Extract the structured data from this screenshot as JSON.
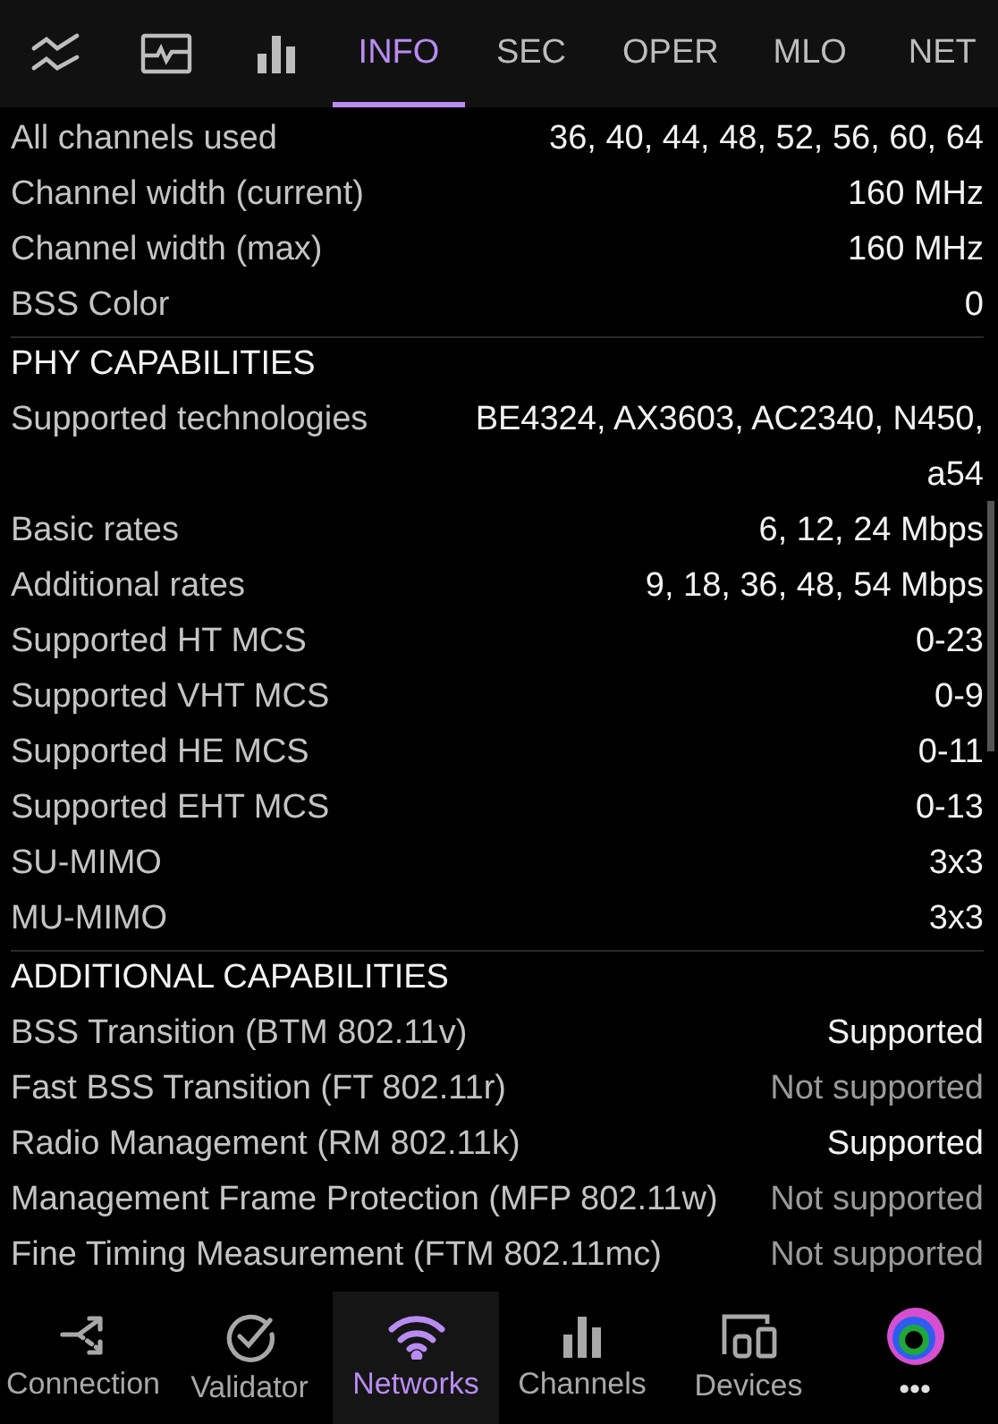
{
  "tabs": [
    {
      "kind": "icon",
      "selected": false
    },
    {
      "kind": "icon",
      "selected": false
    },
    {
      "kind": "icon",
      "selected": false
    },
    {
      "kind": "text",
      "label": "INFO",
      "selected": true
    },
    {
      "kind": "text",
      "label": "SEC",
      "selected": false
    },
    {
      "kind": "text",
      "label": "OPER",
      "selected": false
    },
    {
      "kind": "text",
      "label": "MLO",
      "selected": false
    },
    {
      "kind": "text",
      "label": "NET",
      "selected": false
    }
  ],
  "sections": [
    {
      "rows": [
        {
          "label": "All channels used",
          "value": "36, 40, 44, 48, 52, 56, 60, 64",
          "dimmed": false
        },
        {
          "label": "Channel width (current)",
          "value": "160 MHz",
          "dimmed": false
        },
        {
          "label": "Channel width (max)",
          "value": "160 MHz",
          "dimmed": false
        },
        {
          "label": "BSS Color",
          "value": "0",
          "dimmed": false
        }
      ]
    },
    {
      "title": "PHY CAPABILITIES",
      "rows": [
        {
          "label": "Supported technologies",
          "value": "BE4324, AX3603, AC2340, N450, a54",
          "dimmed": false
        },
        {
          "label": "Basic rates",
          "value": "6, 12, 24 Mbps",
          "dimmed": false
        },
        {
          "label": "Additional rates",
          "value": "9, 18, 36, 48, 54 Mbps",
          "dimmed": false
        },
        {
          "label": "Supported HT MCS",
          "value": "0-23",
          "dimmed": false
        },
        {
          "label": "Supported VHT MCS",
          "value": "0-9",
          "dimmed": false
        },
        {
          "label": "Supported HE MCS",
          "value": "0-11",
          "dimmed": false
        },
        {
          "label": "Supported EHT MCS",
          "value": "0-13",
          "dimmed": false
        },
        {
          "label": "SU-MIMO",
          "value": "3x3",
          "dimmed": false
        },
        {
          "label": "MU-MIMO",
          "value": "3x3",
          "dimmed": false
        }
      ]
    },
    {
      "title": "ADDITIONAL CAPABILITIES",
      "rows": [
        {
          "label": "BSS Transition (BTM 802.11v)",
          "value": "Supported",
          "dimmed": false
        },
        {
          "label": "Fast BSS Transition (FT 802.11r)",
          "value": "Not supported",
          "dimmed": true
        },
        {
          "label": "Radio Management (RM 802.11k)",
          "value": "Supported",
          "dimmed": false
        },
        {
          "label": "Management Frame Protection (MFP 802.11w)",
          "value": "Not supported",
          "dimmed": true
        },
        {
          "label": "Fine Timing Measurement (FTM 802.11mc)",
          "value": "Not supported",
          "dimmed": true
        }
      ]
    }
  ],
  "nav": [
    {
      "label": "Connection",
      "selected": false
    },
    {
      "label": "Validator",
      "selected": false
    },
    {
      "label": "Networks",
      "selected": true
    },
    {
      "label": "Channels",
      "selected": false
    },
    {
      "label": "Devices",
      "selected": false
    },
    {
      "label": "•••",
      "selected": false
    }
  ]
}
